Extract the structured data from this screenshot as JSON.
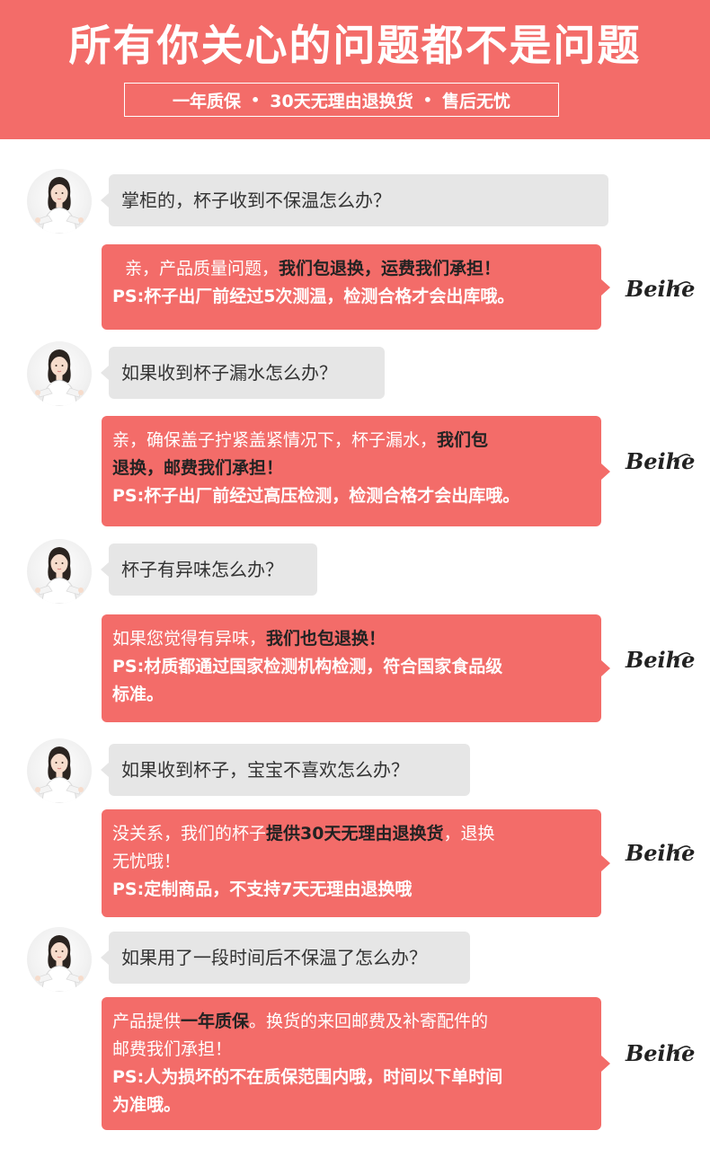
{
  "header": {
    "title": "所有你关心的问题都不是问题",
    "sub": [
      "一年质保",
      "30天无理由退换货",
      "售后无忧"
    ],
    "dot": "•"
  },
  "brand_logo": "Beihe",
  "qa": [
    {
      "q": "掌柜的，杯子收到不保温怎么办？",
      "a": [
        [
          {
            "t": "亲，产品质量问题，"
          },
          {
            "t": "我们包退换，运费我们承担！",
            "b": true
          }
        ],
        [
          {
            "t": "PS:杯子出厂前经过5次测温，检测合格才会出库哦。",
            "ps": true
          }
        ]
      ]
    },
    {
      "q": "如果收到杯子漏水怎么办？",
      "a": [
        [
          {
            "t": "亲，确保盖子拧紧盖紧情况下，杯子漏水，"
          },
          {
            "t": "我们包",
            "b": true
          }
        ],
        [
          {
            "t": "退换，邮费我们承担！",
            "b": true
          }
        ],
        [
          {
            "t": "PS:杯子出厂前经过高压检测，检测合格才会出库哦。",
            "ps": true
          }
        ]
      ]
    },
    {
      "q": "杯子有异味怎么办？",
      "a": [
        [
          {
            "t": "如果您觉得有异味，"
          },
          {
            "t": "我们也包退换！",
            "b": true
          }
        ],
        [
          {
            "t": "PS:材质都通过国家检测机构检测，符合国家食品级",
            "ps": true
          }
        ],
        [
          {
            "t": "标准。",
            "ps": true
          }
        ]
      ]
    },
    {
      "q": "如果收到杯子，宝宝不喜欢怎么办？",
      "a": [
        [
          {
            "t": "没关系，我们的杯子"
          },
          {
            "t": "提供30天无理由退换货",
            "b": true
          },
          {
            "t": "，退换"
          }
        ],
        [
          {
            "t": "无忧哦！"
          }
        ],
        [
          {
            "t": "PS:定制商品，不支持7天无理由退换哦",
            "ps": true
          }
        ]
      ]
    },
    {
      "q": "如果用了一段时间后不保温了怎么办？",
      "a": [
        [
          {
            "t": "产品提供"
          },
          {
            "t": "一年质保",
            "b": true
          },
          {
            "t": "。换货的来回邮费及补寄配件的"
          }
        ],
        [
          {
            "t": "邮费我们承担！"
          }
        ],
        [
          {
            "t": "PS:人为损坏的不在质保范围内哦，时间以下单时间",
            "ps": true
          }
        ],
        [
          {
            "t": "为准哦。",
            "ps": true
          }
        ]
      ]
    }
  ]
}
